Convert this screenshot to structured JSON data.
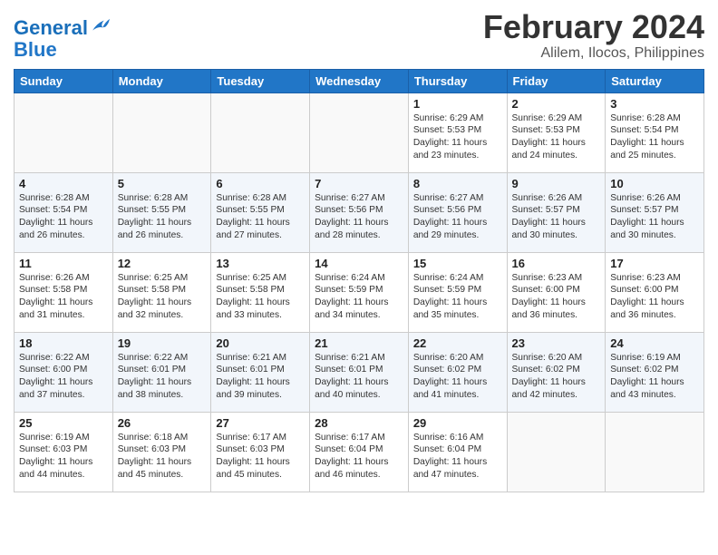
{
  "logo": {
    "text_general": "General",
    "text_blue": "Blue"
  },
  "header": {
    "month": "February 2024",
    "location": "Alilem, Ilocos, Philippines"
  },
  "weekdays": [
    "Sunday",
    "Monday",
    "Tuesday",
    "Wednesday",
    "Thursday",
    "Friday",
    "Saturday"
  ],
  "weeks": [
    [
      {
        "day": "",
        "sunrise": "",
        "sunset": "",
        "daylight": ""
      },
      {
        "day": "",
        "sunrise": "",
        "sunset": "",
        "daylight": ""
      },
      {
        "day": "",
        "sunrise": "",
        "sunset": "",
        "daylight": ""
      },
      {
        "day": "",
        "sunrise": "",
        "sunset": "",
        "daylight": ""
      },
      {
        "day": "1",
        "sunrise": "Sunrise: 6:29 AM",
        "sunset": "Sunset: 5:53 PM",
        "daylight": "Daylight: 11 hours and 23 minutes."
      },
      {
        "day": "2",
        "sunrise": "Sunrise: 6:29 AM",
        "sunset": "Sunset: 5:53 PM",
        "daylight": "Daylight: 11 hours and 24 minutes."
      },
      {
        "day": "3",
        "sunrise": "Sunrise: 6:28 AM",
        "sunset": "Sunset: 5:54 PM",
        "daylight": "Daylight: 11 hours and 25 minutes."
      }
    ],
    [
      {
        "day": "4",
        "sunrise": "Sunrise: 6:28 AM",
        "sunset": "Sunset: 5:54 PM",
        "daylight": "Daylight: 11 hours and 26 minutes."
      },
      {
        "day": "5",
        "sunrise": "Sunrise: 6:28 AM",
        "sunset": "Sunset: 5:55 PM",
        "daylight": "Daylight: 11 hours and 26 minutes."
      },
      {
        "day": "6",
        "sunrise": "Sunrise: 6:28 AM",
        "sunset": "Sunset: 5:55 PM",
        "daylight": "Daylight: 11 hours and 27 minutes."
      },
      {
        "day": "7",
        "sunrise": "Sunrise: 6:27 AM",
        "sunset": "Sunset: 5:56 PM",
        "daylight": "Daylight: 11 hours and 28 minutes."
      },
      {
        "day": "8",
        "sunrise": "Sunrise: 6:27 AM",
        "sunset": "Sunset: 5:56 PM",
        "daylight": "Daylight: 11 hours and 29 minutes."
      },
      {
        "day": "9",
        "sunrise": "Sunrise: 6:26 AM",
        "sunset": "Sunset: 5:57 PM",
        "daylight": "Daylight: 11 hours and 30 minutes."
      },
      {
        "day": "10",
        "sunrise": "Sunrise: 6:26 AM",
        "sunset": "Sunset: 5:57 PM",
        "daylight": "Daylight: 11 hours and 30 minutes."
      }
    ],
    [
      {
        "day": "11",
        "sunrise": "Sunrise: 6:26 AM",
        "sunset": "Sunset: 5:58 PM",
        "daylight": "Daylight: 11 hours and 31 minutes."
      },
      {
        "day": "12",
        "sunrise": "Sunrise: 6:25 AM",
        "sunset": "Sunset: 5:58 PM",
        "daylight": "Daylight: 11 hours and 32 minutes."
      },
      {
        "day": "13",
        "sunrise": "Sunrise: 6:25 AM",
        "sunset": "Sunset: 5:58 PM",
        "daylight": "Daylight: 11 hours and 33 minutes."
      },
      {
        "day": "14",
        "sunrise": "Sunrise: 6:24 AM",
        "sunset": "Sunset: 5:59 PM",
        "daylight": "Daylight: 11 hours and 34 minutes."
      },
      {
        "day": "15",
        "sunrise": "Sunrise: 6:24 AM",
        "sunset": "Sunset: 5:59 PM",
        "daylight": "Daylight: 11 hours and 35 minutes."
      },
      {
        "day": "16",
        "sunrise": "Sunrise: 6:23 AM",
        "sunset": "Sunset: 6:00 PM",
        "daylight": "Daylight: 11 hours and 36 minutes."
      },
      {
        "day": "17",
        "sunrise": "Sunrise: 6:23 AM",
        "sunset": "Sunset: 6:00 PM",
        "daylight": "Daylight: 11 hours and 36 minutes."
      }
    ],
    [
      {
        "day": "18",
        "sunrise": "Sunrise: 6:22 AM",
        "sunset": "Sunset: 6:00 PM",
        "daylight": "Daylight: 11 hours and 37 minutes."
      },
      {
        "day": "19",
        "sunrise": "Sunrise: 6:22 AM",
        "sunset": "Sunset: 6:01 PM",
        "daylight": "Daylight: 11 hours and 38 minutes."
      },
      {
        "day": "20",
        "sunrise": "Sunrise: 6:21 AM",
        "sunset": "Sunset: 6:01 PM",
        "daylight": "Daylight: 11 hours and 39 minutes."
      },
      {
        "day": "21",
        "sunrise": "Sunrise: 6:21 AM",
        "sunset": "Sunset: 6:01 PM",
        "daylight": "Daylight: 11 hours and 40 minutes."
      },
      {
        "day": "22",
        "sunrise": "Sunrise: 6:20 AM",
        "sunset": "Sunset: 6:02 PM",
        "daylight": "Daylight: 11 hours and 41 minutes."
      },
      {
        "day": "23",
        "sunrise": "Sunrise: 6:20 AM",
        "sunset": "Sunset: 6:02 PM",
        "daylight": "Daylight: 11 hours and 42 minutes."
      },
      {
        "day": "24",
        "sunrise": "Sunrise: 6:19 AM",
        "sunset": "Sunset: 6:02 PM",
        "daylight": "Daylight: 11 hours and 43 minutes."
      }
    ],
    [
      {
        "day": "25",
        "sunrise": "Sunrise: 6:19 AM",
        "sunset": "Sunset: 6:03 PM",
        "daylight": "Daylight: 11 hours and 44 minutes."
      },
      {
        "day": "26",
        "sunrise": "Sunrise: 6:18 AM",
        "sunset": "Sunset: 6:03 PM",
        "daylight": "Daylight: 11 hours and 45 minutes."
      },
      {
        "day": "27",
        "sunrise": "Sunrise: 6:17 AM",
        "sunset": "Sunset: 6:03 PM",
        "daylight": "Daylight: 11 hours and 45 minutes."
      },
      {
        "day": "28",
        "sunrise": "Sunrise: 6:17 AM",
        "sunset": "Sunset: 6:04 PM",
        "daylight": "Daylight: 11 hours and 46 minutes."
      },
      {
        "day": "29",
        "sunrise": "Sunrise: 6:16 AM",
        "sunset": "Sunset: 6:04 PM",
        "daylight": "Daylight: 11 hours and 47 minutes."
      },
      {
        "day": "",
        "sunrise": "",
        "sunset": "",
        "daylight": ""
      },
      {
        "day": "",
        "sunrise": "",
        "sunset": "",
        "daylight": ""
      }
    ]
  ]
}
